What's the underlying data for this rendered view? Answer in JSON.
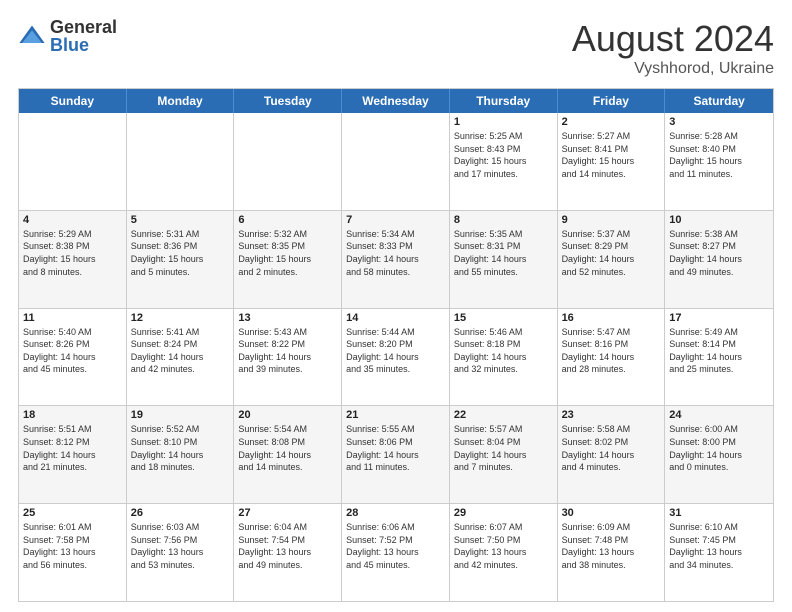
{
  "logo": {
    "general": "General",
    "blue": "Blue"
  },
  "title": "August 2024",
  "subtitle": "Vyshhorod, Ukraine",
  "days": [
    "Sunday",
    "Monday",
    "Tuesday",
    "Wednesday",
    "Thursday",
    "Friday",
    "Saturday"
  ],
  "rows": [
    [
      {
        "day": "",
        "text": ""
      },
      {
        "day": "",
        "text": ""
      },
      {
        "day": "",
        "text": ""
      },
      {
        "day": "",
        "text": ""
      },
      {
        "day": "1",
        "text": "Sunrise: 5:25 AM\nSunset: 8:43 PM\nDaylight: 15 hours\nand 17 minutes."
      },
      {
        "day": "2",
        "text": "Sunrise: 5:27 AM\nSunset: 8:41 PM\nDaylight: 15 hours\nand 14 minutes."
      },
      {
        "day": "3",
        "text": "Sunrise: 5:28 AM\nSunset: 8:40 PM\nDaylight: 15 hours\nand 11 minutes."
      }
    ],
    [
      {
        "day": "4",
        "text": "Sunrise: 5:29 AM\nSunset: 8:38 PM\nDaylight: 15 hours\nand 8 minutes."
      },
      {
        "day": "5",
        "text": "Sunrise: 5:31 AM\nSunset: 8:36 PM\nDaylight: 15 hours\nand 5 minutes."
      },
      {
        "day": "6",
        "text": "Sunrise: 5:32 AM\nSunset: 8:35 PM\nDaylight: 15 hours\nand 2 minutes."
      },
      {
        "day": "7",
        "text": "Sunrise: 5:34 AM\nSunset: 8:33 PM\nDaylight: 14 hours\nand 58 minutes."
      },
      {
        "day": "8",
        "text": "Sunrise: 5:35 AM\nSunset: 8:31 PM\nDaylight: 14 hours\nand 55 minutes."
      },
      {
        "day": "9",
        "text": "Sunrise: 5:37 AM\nSunset: 8:29 PM\nDaylight: 14 hours\nand 52 minutes."
      },
      {
        "day": "10",
        "text": "Sunrise: 5:38 AM\nSunset: 8:27 PM\nDaylight: 14 hours\nand 49 minutes."
      }
    ],
    [
      {
        "day": "11",
        "text": "Sunrise: 5:40 AM\nSunset: 8:26 PM\nDaylight: 14 hours\nand 45 minutes."
      },
      {
        "day": "12",
        "text": "Sunrise: 5:41 AM\nSunset: 8:24 PM\nDaylight: 14 hours\nand 42 minutes."
      },
      {
        "day": "13",
        "text": "Sunrise: 5:43 AM\nSunset: 8:22 PM\nDaylight: 14 hours\nand 39 minutes."
      },
      {
        "day": "14",
        "text": "Sunrise: 5:44 AM\nSunset: 8:20 PM\nDaylight: 14 hours\nand 35 minutes."
      },
      {
        "day": "15",
        "text": "Sunrise: 5:46 AM\nSunset: 8:18 PM\nDaylight: 14 hours\nand 32 minutes."
      },
      {
        "day": "16",
        "text": "Sunrise: 5:47 AM\nSunset: 8:16 PM\nDaylight: 14 hours\nand 28 minutes."
      },
      {
        "day": "17",
        "text": "Sunrise: 5:49 AM\nSunset: 8:14 PM\nDaylight: 14 hours\nand 25 minutes."
      }
    ],
    [
      {
        "day": "18",
        "text": "Sunrise: 5:51 AM\nSunset: 8:12 PM\nDaylight: 14 hours\nand 21 minutes."
      },
      {
        "day": "19",
        "text": "Sunrise: 5:52 AM\nSunset: 8:10 PM\nDaylight: 14 hours\nand 18 minutes."
      },
      {
        "day": "20",
        "text": "Sunrise: 5:54 AM\nSunset: 8:08 PM\nDaylight: 14 hours\nand 14 minutes."
      },
      {
        "day": "21",
        "text": "Sunrise: 5:55 AM\nSunset: 8:06 PM\nDaylight: 14 hours\nand 11 minutes."
      },
      {
        "day": "22",
        "text": "Sunrise: 5:57 AM\nSunset: 8:04 PM\nDaylight: 14 hours\nand 7 minutes."
      },
      {
        "day": "23",
        "text": "Sunrise: 5:58 AM\nSunset: 8:02 PM\nDaylight: 14 hours\nand 4 minutes."
      },
      {
        "day": "24",
        "text": "Sunrise: 6:00 AM\nSunset: 8:00 PM\nDaylight: 14 hours\nand 0 minutes."
      }
    ],
    [
      {
        "day": "25",
        "text": "Sunrise: 6:01 AM\nSunset: 7:58 PM\nDaylight: 13 hours\nand 56 minutes."
      },
      {
        "day": "26",
        "text": "Sunrise: 6:03 AM\nSunset: 7:56 PM\nDaylight: 13 hours\nand 53 minutes."
      },
      {
        "day": "27",
        "text": "Sunrise: 6:04 AM\nSunset: 7:54 PM\nDaylight: 13 hours\nand 49 minutes."
      },
      {
        "day": "28",
        "text": "Sunrise: 6:06 AM\nSunset: 7:52 PM\nDaylight: 13 hours\nand 45 minutes."
      },
      {
        "day": "29",
        "text": "Sunrise: 6:07 AM\nSunset: 7:50 PM\nDaylight: 13 hours\nand 42 minutes."
      },
      {
        "day": "30",
        "text": "Sunrise: 6:09 AM\nSunset: 7:48 PM\nDaylight: 13 hours\nand 38 minutes."
      },
      {
        "day": "31",
        "text": "Sunrise: 6:10 AM\nSunset: 7:45 PM\nDaylight: 13 hours\nand 34 minutes."
      }
    ]
  ]
}
